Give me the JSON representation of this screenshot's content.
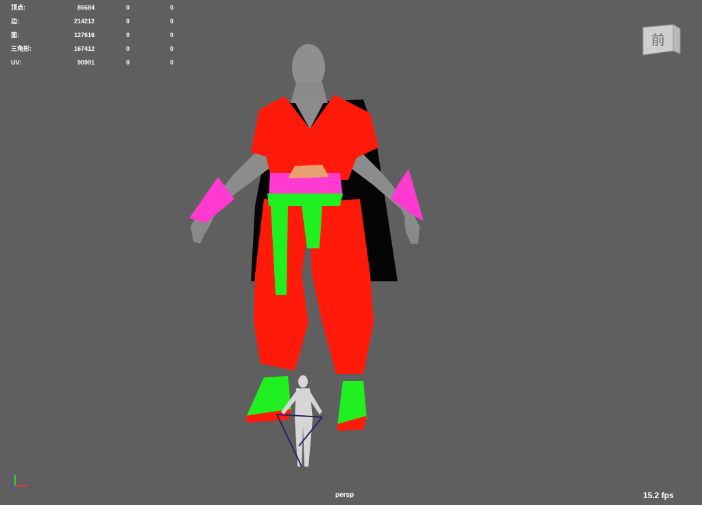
{
  "stats": [
    {
      "label": "顶点:",
      "v1": "86684",
      "v2": "0",
      "v3": "0"
    },
    {
      "label": "边:",
      "v1": "214212",
      "v2": "0",
      "v3": "0"
    },
    {
      "label": "面:",
      "v1": "127616",
      "v2": "0",
      "v3": "0"
    },
    {
      "label": "三角形:",
      "v1": "167412",
      "v2": "0",
      "v3": "0"
    },
    {
      "label": "UV:",
      "v1": "90991",
      "v2": "0",
      "v3": "0"
    }
  ],
  "viewcube": {
    "face_label": "前"
  },
  "camera": {
    "name": "persp"
  },
  "fps": "15.2 fps",
  "colors": {
    "background": "#5f5f5f",
    "cloth_red": "#ff1a0a",
    "cloth_pink": "#ff3ad0",
    "cloth_green": "#20f020",
    "skin_gray": "#8d8d8d",
    "cape_black": "#050505"
  }
}
